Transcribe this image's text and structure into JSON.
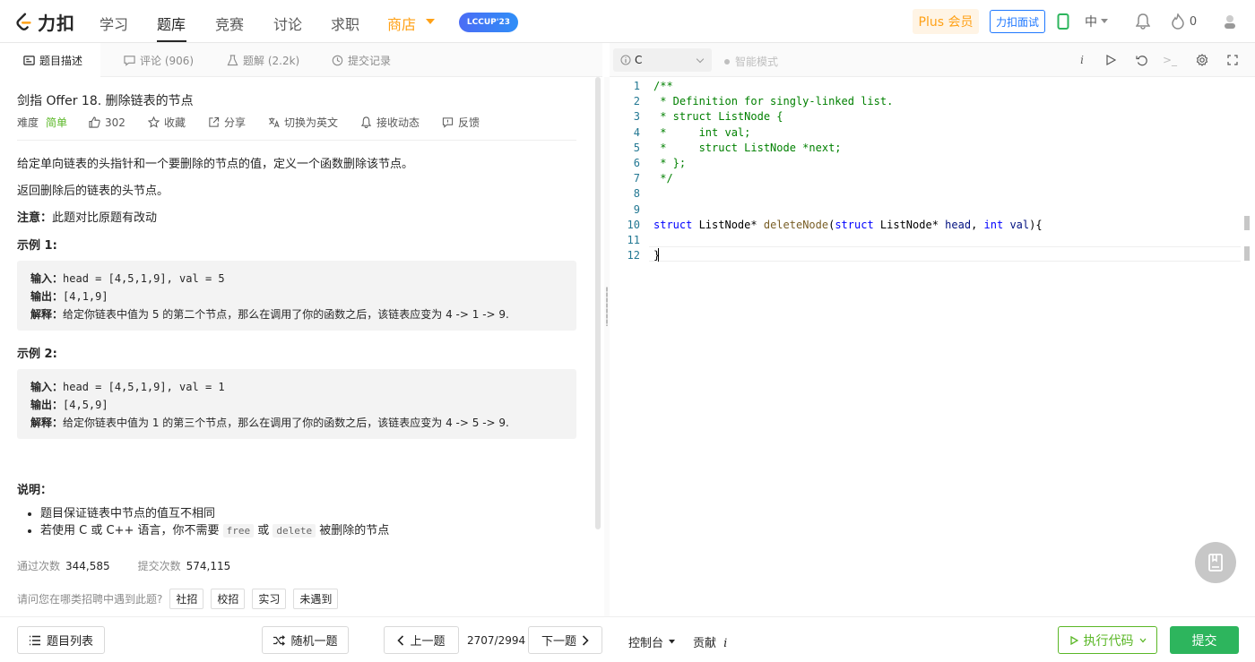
{
  "nav": {
    "logo_text": "力扣",
    "items": [
      "学习",
      "题库",
      "竞赛",
      "讨论",
      "求职",
      "商店"
    ],
    "lccup_label": "LCCUP'23",
    "plus_label": "Plus 会员",
    "interview_label": "力扣面试",
    "lang_label": "中",
    "fire_count": "0"
  },
  "left_tabs": {
    "description": "题目描述",
    "comments": "评论 (906)",
    "solutions": "题解 (2.2k)",
    "submissions": "提交记录"
  },
  "problem": {
    "title": "剑指 Offer 18. 删除链表的节点",
    "difficulty_label": "难度",
    "difficulty": "简单",
    "likes": "302",
    "favorite": "收藏",
    "share": "分享",
    "switch_lang": "切换为英文",
    "notify": "接收动态",
    "feedback": "反馈",
    "desc1": "给定单向链表的头指针和一个要删除的节点的值，定义一个函数删除该节点。",
    "desc2": "返回删除后的链表的头节点。",
    "note_label": "注意：",
    "note_text": "此题对比原题有改动",
    "example1_title": "示例 1:",
    "example1": {
      "input_label": "输入：",
      "input": "head = [4,5,1,9], val = 5",
      "output_label": "输出：",
      "output": "[4,1,9]",
      "explain_label": "解释：",
      "explain": "给定你链表中值为 5 的第二个节点，那么在调用了你的函数之后，该链表应变为 4 -> 1 -> 9."
    },
    "example2_title": "示例 2:",
    "example2": {
      "input_label": "输入：",
      "input": "head = [4,5,1,9], val = 1",
      "output_label": "输出：",
      "output": "[4,5,9]",
      "explain_label": "解释：",
      "explain": "给定你链表中值为 1 的第三个节点，那么在调用了你的函数之后，该链表应变为 4 -> 5 -> 9."
    },
    "notes_title": "说明：",
    "bullet1": "题目保证链表中节点的值互不相同",
    "bullet2_pre": "若使用 C 或 C++ 语言，你不需要 ",
    "bullet2_code1": "free",
    "bullet2_mid": " 或 ",
    "bullet2_code2": "delete",
    "bullet2_post": " 被删除的节点",
    "accepted_label": "通过次数",
    "accepted": "344,585",
    "submitted_label": "提交次数",
    "submitted": "574,115",
    "recruit_question": "请问您在哪类招聘中遇到此题?",
    "recruit_tags": [
      "社招",
      "校招",
      "实习",
      "未遇到"
    ]
  },
  "editor": {
    "language": "C",
    "smart_mode": "智能模式",
    "line_numbers": [
      "1",
      "2",
      "3",
      "4",
      "5",
      "6",
      "7",
      "8",
      "9",
      "10",
      "11",
      "12"
    ]
  },
  "bottom": {
    "problem_list": "题目列表",
    "random": "随机一题",
    "prev": "上一题",
    "count": "2707/2994",
    "next": "下一题",
    "console": "控制台",
    "contribute": "贡献",
    "run": "执行代码",
    "submit": "提交"
  },
  "colors": {
    "accent_orange": "#ffa116",
    "easy_green": "#5ab726",
    "submit_green": "#2db55d",
    "link_blue": "#1f78ff"
  }
}
